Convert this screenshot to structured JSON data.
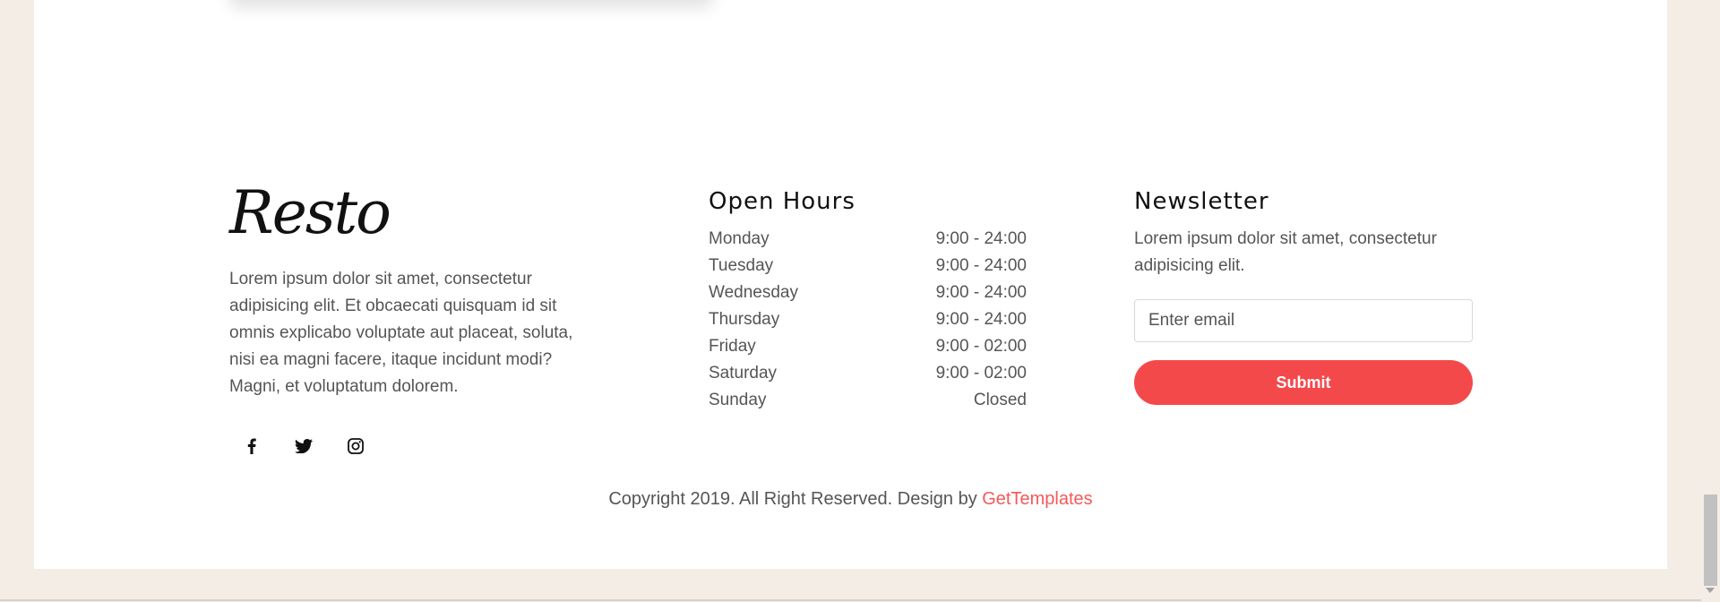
{
  "brand": {
    "logo": "Resto",
    "about": "Lorem ipsum dolor sit amet, consectetur adipisicing elit. Et obcaecati quisquam id sit omnis explicabo voluptate aut placeat, soluta, nisi ea magni facere, itaque incidunt modi? Magni, et voluptatum dolorem.",
    "social": [
      "facebook-icon",
      "twitter-icon",
      "instagram-icon"
    ]
  },
  "hours": {
    "title": "Open Hours",
    "rows": [
      {
        "day": "Monday",
        "time": "9:00 - 24:00"
      },
      {
        "day": "Tuesday",
        "time": "9:00 - 24:00"
      },
      {
        "day": "Wednesday",
        "time": "9:00 - 24:00"
      },
      {
        "day": "Thursday",
        "time": "9:00 - 24:00"
      },
      {
        "day": "Friday",
        "time": "9:00 - 02:00"
      },
      {
        "day": "Saturday",
        "time": "9:00 - 02:00"
      },
      {
        "day": "Sunday",
        "time": "Closed"
      }
    ]
  },
  "newsletter": {
    "title": "Newsletter",
    "text": "Lorem ipsum dolor sit amet, consectetur adipisicing elit.",
    "email_placeholder": "Enter email",
    "submit_label": "Submit"
  },
  "footer": {
    "copyright": "Copyright 2019. All Right Reserved. Design by ",
    "link_text": "GetTemplates"
  },
  "colors": {
    "accent": "#f4494b",
    "page_bg": "#f3ede6",
    "text": "#555555",
    "heading": "#111111"
  }
}
